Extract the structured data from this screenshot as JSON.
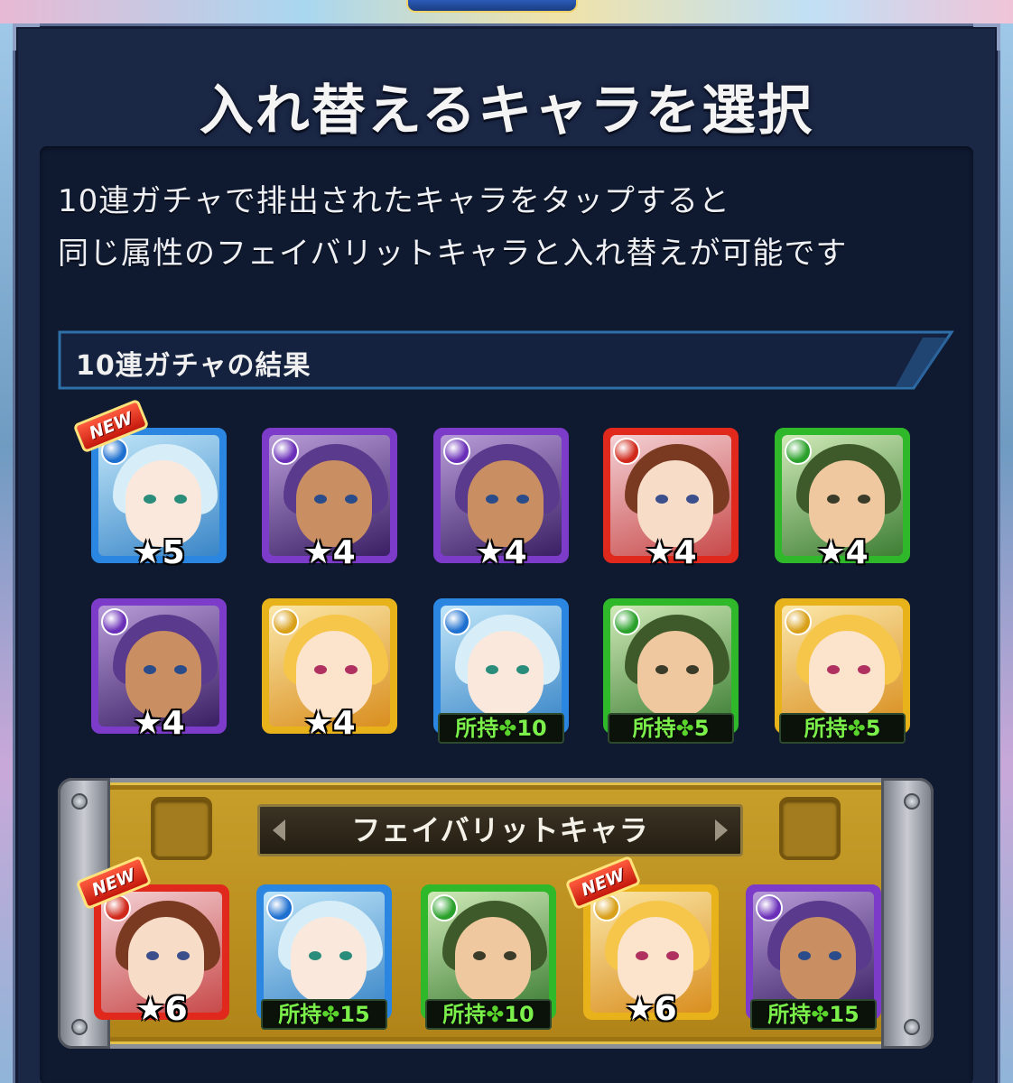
{
  "dialog": {
    "title": "入れ替えるキャラを選択",
    "description_line1": "10連ガチャで排出されたキャラをタップすると",
    "description_line2": "同じ属性のフェイバリットキャラと入れ替えが可能です"
  },
  "gacha_section": {
    "label": "10連ガチャの結果",
    "results": [
      {
        "element": "water",
        "rarity": "★5",
        "new": true,
        "new_label": "NEW"
      },
      {
        "element": "dark",
        "rarity": "★4",
        "new": false
      },
      {
        "element": "dark",
        "rarity": "★4",
        "new": false
      },
      {
        "element": "fire",
        "rarity": "★4",
        "new": false
      },
      {
        "element": "wood",
        "rarity": "★4",
        "new": false
      },
      {
        "element": "dark",
        "rarity": "★4",
        "new": false
      },
      {
        "element": "light",
        "rarity": "★4",
        "new": false
      },
      {
        "element": "water",
        "owned": "所持",
        "owned_count": "10"
      },
      {
        "element": "wood",
        "owned": "所持",
        "owned_count": "5"
      },
      {
        "element": "light",
        "owned": "所持",
        "owned_count": "5"
      }
    ]
  },
  "favorite_section": {
    "label": "フェイバリットキャラ",
    "characters": [
      {
        "element": "fire",
        "rarity": "★6",
        "new": true,
        "new_label": "NEW"
      },
      {
        "element": "water",
        "owned": "所持",
        "owned_count": "15"
      },
      {
        "element": "wood",
        "owned": "所持",
        "owned_count": "10"
      },
      {
        "element": "light",
        "rarity": "★6",
        "new": true,
        "new_label": "NEW"
      },
      {
        "element": "dark",
        "owned": "所持",
        "owned_count": "15"
      }
    ]
  },
  "colors": {
    "fire": "#e0281c",
    "water": "#2a86e0",
    "wood": "#2fb82a",
    "light": "#e8b21a",
    "dark": "#7c3bc8",
    "panel": "#1a2745",
    "owned_text": "#7bf04a"
  }
}
